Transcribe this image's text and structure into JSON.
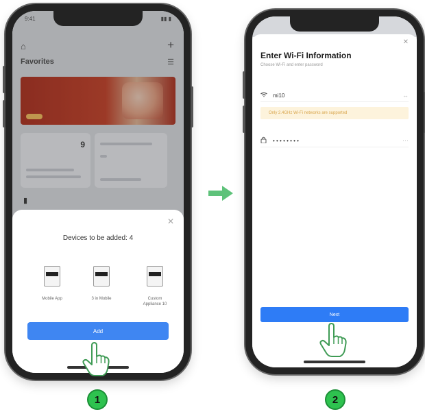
{
  "phone1": {
    "status_time": "9:41",
    "status_right": "▮▮ ▮",
    "page_title": "Favorites",
    "card_number": "9",
    "sheet_title": "Devices to be added: 4",
    "devices": [
      {
        "label": "Mobile App"
      },
      {
        "label": "3 in Mobile"
      },
      {
        "label": "Custom\nAppliance 10"
      }
    ],
    "add_button_label": "Add"
  },
  "phone2": {
    "title": "Enter Wi-Fi Information",
    "subtitle": "Choose Wi-Fi and enter password",
    "ssid": "mi10",
    "warning": "Only 2.4GHz Wi-Fi networks are supported",
    "password_mask": "• • • • • • • •",
    "next_button_label": "Next"
  },
  "steps": [
    "1",
    "2"
  ],
  "colors": {
    "accent_blue": "#3f86f2",
    "step_green": "#2ec24f",
    "arrow_green": "#5ec27a"
  },
  "icons": {
    "home": "home-icon",
    "plus": "plus-icon",
    "wifi": "wifi-icon",
    "lock": "lock-icon",
    "hand": "hand-pointer-icon",
    "arrow": "arrow-right-icon"
  }
}
